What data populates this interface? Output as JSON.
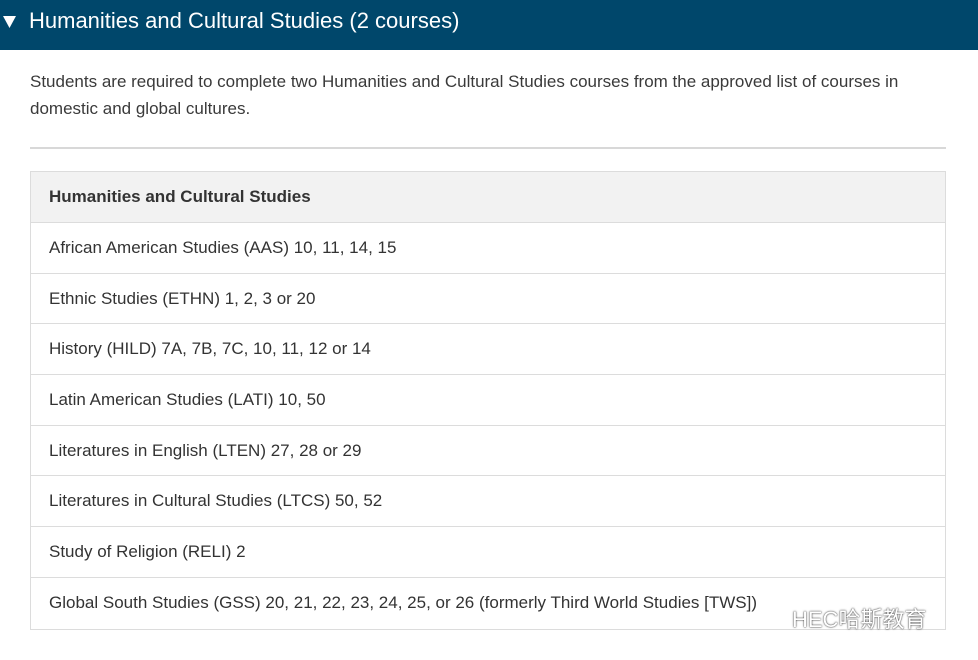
{
  "accordion": {
    "title": "Humanities and Cultural Studies (2 courses)",
    "toggle_icon": "triangle-down-icon",
    "expanded": true,
    "header_color": "#00476b"
  },
  "intro": {
    "text": "Students are required to complete two Humanities and Cultural Studies courses from the approved list of courses in domestic and global cultures."
  },
  "table": {
    "header": "Humanities and Cultural Studies",
    "rows": [
      "African American Studies (AAS) 10, 11, 14, 15",
      "Ethnic Studies (ETHN) 1, 2, 3 or 20",
      "History (HILD) 7A, 7B, 7C, 10, 11, 12 or 14",
      "Latin American Studies (LATI) 10, 50",
      "Literatures in English (LTEN) 27, 28 or 29",
      "Literatures in Cultural Studies (LTCS) 50, 52",
      "Study of Religion (RELI) 2",
      "Global South Studies (GSS) 20, 21, 22, 23, 24, 25, or 26 (formerly Third World Studies [TWS])"
    ]
  },
  "watermark": {
    "icon": "wechat-icon",
    "text": "HEC哈斯教育"
  }
}
